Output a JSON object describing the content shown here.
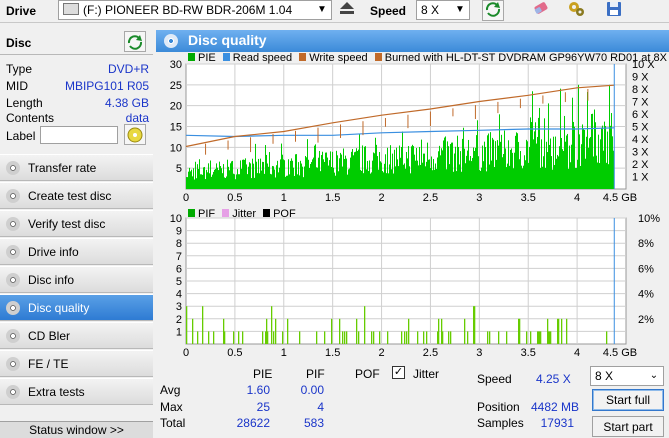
{
  "toolbar": {
    "drive_label": "Drive",
    "drive_value": "(F:)  PIONEER BD-RW   BDR-206M 1.04",
    "speed_label": "Speed",
    "speed_value": "8 X"
  },
  "disc": {
    "heading": "Disc",
    "type_label": "Type",
    "type_value": "DVD+R",
    "mid_label": "MID",
    "mid_value": "MBIPG101 R05",
    "length_label": "Length",
    "length_value": "4.38 GB",
    "contents_label": "Contents",
    "contents_value": "data",
    "label_label": "Label",
    "label_value": ""
  },
  "nav": [
    {
      "label": "Transfer rate"
    },
    {
      "label": "Create test disc"
    },
    {
      "label": "Verify test disc"
    },
    {
      "label": "Drive info"
    },
    {
      "label": "Disc info"
    },
    {
      "label": "Disc quality"
    },
    {
      "label": "CD Bler"
    },
    {
      "label": "FE / TE"
    },
    {
      "label": "Extra tests"
    }
  ],
  "status_window": "Status window >>",
  "main_title": "Disc quality",
  "chart_data": [
    {
      "type": "line",
      "legend": [
        "PIE",
        "Read speed",
        "Write speed",
        "Burned with HL-DT-ST DVDRAM GP96YW70 RD01 at 8X"
      ],
      "colors": {
        "pie": "#00cc00",
        "read": "#3a8fe0",
        "write": "#c06a2a"
      },
      "x_ticks": [
        "0",
        "0.5",
        "1",
        "1.5",
        "2",
        "2.5",
        "3",
        "3.5",
        "4",
        "4.5 GB"
      ],
      "y_left_ticks": [
        "5",
        "10",
        "15",
        "20",
        "25",
        "30"
      ],
      "y_right_ticks": [
        "1 X",
        "2 X",
        "3 X",
        "4 X",
        "5 X",
        "6 X",
        "7 X",
        "8 X",
        "9 X",
        "10 X"
      ],
      "xlim": [
        0,
        4.5
      ],
      "ylim": [
        0,
        30
      ],
      "y2lim": [
        0,
        10
      ],
      "series": [
        {
          "name": "Read speed",
          "x": [
            0,
            0.5,
            1,
            1.5,
            2,
            2.5,
            3,
            3.5,
            4,
            4.38
          ],
          "y": [
            4.3,
            4.2,
            4.3,
            4.3,
            4.5,
            4.6,
            4.7,
            4.8,
            4.8,
            4.9
          ]
        },
        {
          "name": "Write speed",
          "x": [
            0,
            0.5,
            1,
            1.5,
            2,
            2.5,
            3,
            3.5,
            4,
            4.38
          ],
          "y": [
            3.4,
            4.2,
            4.6,
            5.3,
            5.9,
            6.4,
            7.0,
            7.5,
            8.1,
            8.3
          ]
        }
      ]
    },
    {
      "type": "bar",
      "legend": [
        "PIF",
        "Jitter",
        "POF"
      ],
      "colors": {
        "pif": "#66cc00",
        "jitter": "#e6a0e6",
        "pof": "#000000"
      },
      "x_ticks": [
        "0",
        "0.5",
        "1",
        "1.5",
        "2",
        "2.5",
        "3",
        "3.5",
        "4",
        "4.5 GB"
      ],
      "y_left_ticks": [
        "1",
        "2",
        "3",
        "4",
        "5",
        "6",
        "7",
        "8",
        "9",
        "10"
      ],
      "y_right_ticks": [
        "2%",
        "4%",
        "6%",
        "8%",
        "10%"
      ],
      "xlim": [
        0,
        4.5
      ],
      "ylim": [
        0,
        10
      ]
    }
  ],
  "stats": {
    "col_pie": "PIE",
    "col_pif": "PIF",
    "col_pof": "POF",
    "jitter_label": "Jitter",
    "avg_label": "Avg",
    "avg_pie": "1.60",
    "avg_pif": "0.00",
    "max_label": "Max",
    "max_pie": "25",
    "max_pif": "4",
    "total_label": "Total",
    "total_pie": "28622",
    "total_pif": "583",
    "speed_label": "Speed",
    "speed_value": "4.25 X",
    "speed_select": "8 X",
    "position_label": "Position",
    "position_value": "4482 MB",
    "samples_label": "Samples",
    "samples_value": "17931",
    "start_full": "Start full",
    "start_part": "Start part"
  }
}
